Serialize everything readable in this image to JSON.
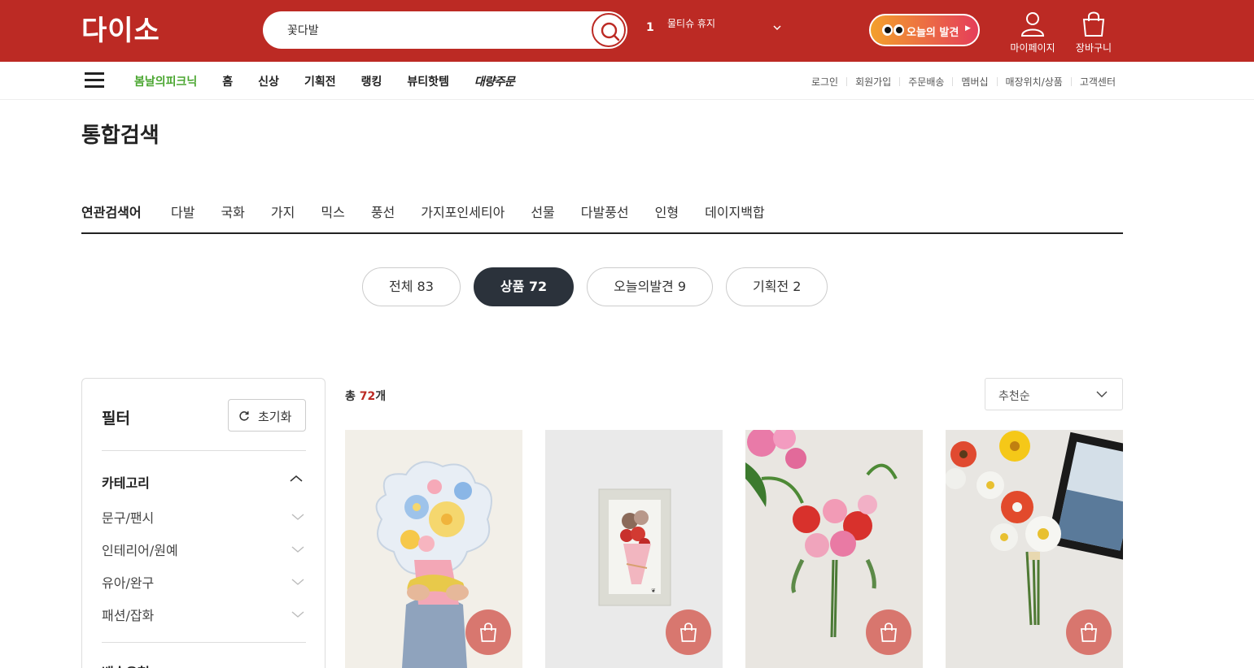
{
  "header": {
    "logo": "다이소",
    "search": {
      "value": "꽃다발",
      "button_icon": "search-icon"
    },
    "rank": {
      "number": "1",
      "text": "물티슈\n휴지"
    },
    "today_button": "오늘의 발견",
    "mypage_label": "마이페이지",
    "cart_label": "장바구니",
    "brand_color": "#bc2a24"
  },
  "nav": {
    "menu": [
      "봄날의피크닉",
      "홈",
      "신상",
      "기획전",
      "랭킹",
      "뷰티핫템",
      "대량주문"
    ],
    "util": [
      "로그인",
      "회원가입",
      "주문배송",
      "멤버십",
      "매장위치/상품",
      "고객센터"
    ]
  },
  "page": {
    "title": "통합검색",
    "related_label": "연관검색어",
    "related": [
      "다발",
      "국화",
      "가지",
      "믹스",
      "풍선",
      "가지포인세티아",
      "선물",
      "다발풍선",
      "인형",
      "데이지백합"
    ]
  },
  "tabs": [
    {
      "label": "전체 83",
      "active": false
    },
    {
      "label": "상품 72",
      "active": true
    },
    {
      "label": "오늘의발견 9",
      "active": false
    },
    {
      "label": "기획전 2",
      "active": false
    }
  ],
  "filter": {
    "title": "필터",
    "reset_label": "초기화",
    "category_title": "카테고리",
    "categories": [
      "문구/팬시",
      "인테리어/원예",
      "유아/완구",
      "패션/잡화"
    ],
    "shipping_title": "배송유형"
  },
  "results": {
    "total_prefix": "총 ",
    "total_count": "72",
    "total_suffix": "개",
    "sort_label": "추천순"
  },
  "products": [
    {
      "name": "flower-balloon-bouquet"
    },
    {
      "name": "boxed-rose-bouquet"
    },
    {
      "name": "pink-red-carnation-bouquet"
    },
    {
      "name": "gerbera-bouquet"
    }
  ]
}
